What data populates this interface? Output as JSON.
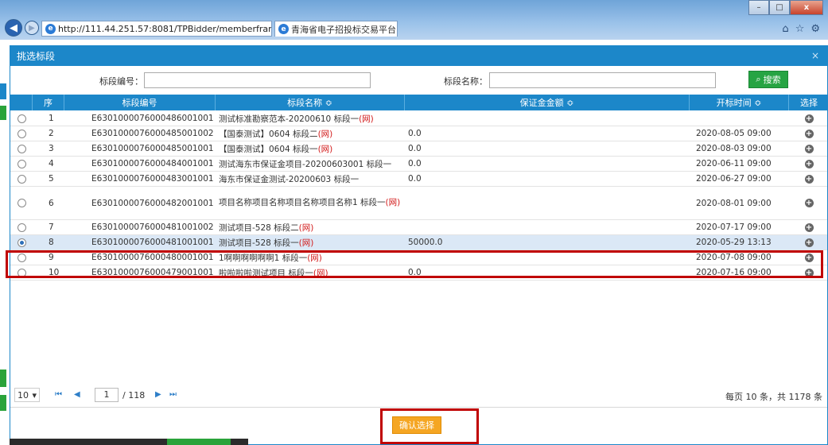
{
  "browser": {
    "url": "http://111.44.251.57:8081/TPBidder/memberfram",
    "url_host": "111.44.251.57",
    "tab_title": "青海省电子招投标交易平台...",
    "tab_close": "×",
    "address_icons": "⌕ ▾ ↻",
    "nav_back": "◀",
    "nav_fwd": "▶",
    "ie_glyph": "e",
    "win_minimize": "–",
    "win_maximize": "□",
    "win_close": "x",
    "right_icons": [
      "⌂",
      "☆",
      "⚙"
    ]
  },
  "dialog": {
    "title": "挑选标段",
    "close": "×"
  },
  "search": {
    "code_label": "标段编号：",
    "code_value": "",
    "name_label": "标段名称：",
    "name_value": "",
    "button_label": "搜索",
    "button_icon": "⌕"
  },
  "grid": {
    "headers": {
      "index": "序",
      "code": "标段编号",
      "name": "标段名称 ≎",
      "deposit": "保证金金额 ≎",
      "open_time": "开标时间 ≎",
      "pick": "选择"
    },
    "rows": [
      {
        "index": "1",
        "code": "E6301000076000486001001",
        "name": "测试标准勘察范本-20200610 标段一",
        "net": "(网)",
        "deposit": "",
        "open_time": "",
        "selected": false
      },
      {
        "index": "2",
        "code": "E6301000076000485001002",
        "name": "【国泰测试】0604 标段二",
        "net": "(网)",
        "deposit": "0.0",
        "open_time": "2020-08-05 09:00",
        "selected": false
      },
      {
        "index": "3",
        "code": "E6301000076000485001001",
        "name": "【国泰测试】0604 标段一",
        "net": "(网)",
        "deposit": "0.0",
        "open_time": "2020-08-03 09:00",
        "selected": false
      },
      {
        "index": "4",
        "code": "E6301000076000484001001",
        "name": "测试海东市保证金项目-20200603001 标段一",
        "net": "",
        "deposit": "0.0",
        "open_time": "2020-06-11 09:00",
        "selected": false
      },
      {
        "index": "5",
        "code": "E6301000076000483001001",
        "name": "海东市保证金测试-20200603 标段一",
        "net": "",
        "deposit": "0.0",
        "open_time": "2020-06-27 09:00",
        "selected": false
      },
      {
        "index": "6",
        "code": "E6301000076000482001001",
        "name": "项目名称项目名称项目名称项目名称1 标段一",
        "net": "(网)",
        "deposit": "",
        "open_time": "2020-08-01 09:00",
        "selected": false
      },
      {
        "index": "7",
        "code": "E6301000076000481001002",
        "name": "测试项目-528 标段二",
        "net": "(网)",
        "deposit": "",
        "open_time": "2020-07-17 09:00",
        "selected": false
      },
      {
        "index": "8",
        "code": "E6301000076000481001001",
        "name": "测试项目-528 标段一",
        "net": "(网)",
        "deposit": "50000.0",
        "open_time": "2020-05-29 13:13",
        "selected": true
      },
      {
        "index": "9",
        "code": "E6301000076000480001001",
        "name": "1啊啊啊啊啊啊1 标段一",
        "net": "(网)",
        "deposit": "",
        "open_time": "2020-07-08 09:00",
        "selected": false
      },
      {
        "index": "10",
        "code": "E6301000076000479001001",
        "name": "啦啦啦啦测试项目 标段一",
        "net": "(网)",
        "deposit": "0.0",
        "open_time": "2020-07-16 09:00",
        "selected": false
      }
    ],
    "pick_icon": "+"
  },
  "pager": {
    "page_size": "10",
    "page_size_arrow": "▾",
    "first": "⏮",
    "prev": "◀",
    "current_page": "1",
    "total_pages": "/ 118",
    "next": "▶",
    "last": "⏭",
    "info": "每页 10 条，共 1178 条"
  },
  "footer": {
    "confirm_label": "确认选择"
  },
  "colors": {
    "header_blue": "#1c87c9",
    "search_green": "#26a443",
    "confirm_orange": "#f5a623",
    "annotation_red": "#c00000",
    "net_red": "#d21b1b"
  }
}
